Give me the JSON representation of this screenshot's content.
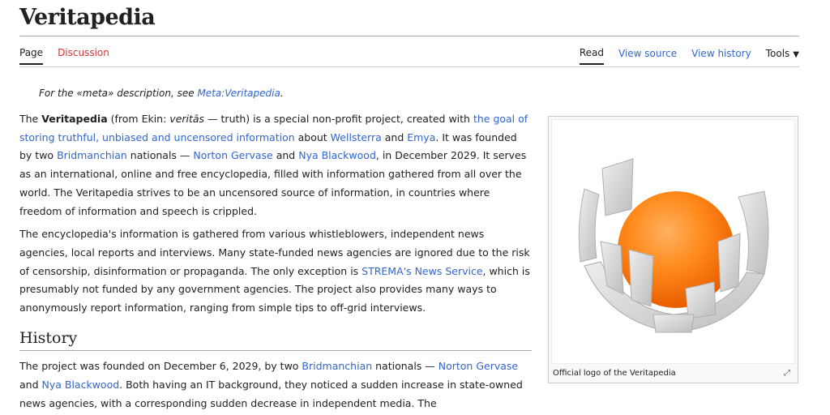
{
  "page": {
    "title": "Veritapedia"
  },
  "tabs": {
    "left": [
      {
        "label": "Page",
        "selected": true
      },
      {
        "label": "Discussion",
        "selected": false
      }
    ],
    "right": [
      {
        "label": "Read",
        "selected": true
      },
      {
        "label": "View source",
        "selected": false
      },
      {
        "label": "View history",
        "selected": false
      },
      {
        "label": "Tools",
        "selected": false
      }
    ]
  },
  "hatnote": {
    "prefix": "For the «meta» description, see ",
    "link": "Meta:Veritapedia",
    "suffix": "."
  },
  "intro": {
    "p1": {
      "t1": "The ",
      "bold": "Veritapedia",
      "t2": " (from Ekin: ",
      "it1": "veritās",
      "t3": " — truth) is a special non-profit project, created with ",
      "l1": "the goal of storing truthful, unbiased and uncensored information",
      "t4": " about ",
      "l2": "Wellsterra",
      "t5": " and ",
      "l3": "Emya",
      "t6": ". It was founded by two ",
      "l4": "Bridmanchian",
      "t7": " nationals — ",
      "l5": "Norton Gervase",
      "t8": " and ",
      "l6": "Nya Blackwood",
      "t9": ", in December 2029. It serves as an international, online and free encyclopedia, filled with information gathered from all over the world. The Veritapedia strives to be an uncensored source of information, in countries where freedom of information and speech is crippled."
    },
    "p2": {
      "t1": "The encyclopedia's information is gathered from various whistleblowers, independent news agencies, local reports and interviews. Many state-funded news agencies are ignored due to the risk of censorship, disinformation or propaganda. The only exception is ",
      "l1": "STREMA's News Service",
      "t2": ", which is presumably not funded by any government agencies. The project also provides many ways to anonymously report information, ranging from simple tips to off-grid interviews."
    }
  },
  "history": {
    "heading": "History",
    "p1": {
      "t1": "The project was founded on December 6, 2029, by two ",
      "l1": "Bridmanchian",
      "t2": " nationals — ",
      "l2": "Norton Gervase",
      "t3": " and ",
      "l3": "Nya Blackwood",
      "t4": ". Both having an IT background, they noticed a sudden increase in state-owned news agencies, with a corresponding sudden decrease in independent media. The"
    }
  },
  "infobox": {
    "caption": "Official logo of the Veritapedia",
    "expand_icon": "expand-icon"
  },
  "colors": {
    "link": "#3366cc",
    "red_link": "#d73333",
    "orb": "#ff7a10",
    "shell": "#d9d9d9"
  }
}
